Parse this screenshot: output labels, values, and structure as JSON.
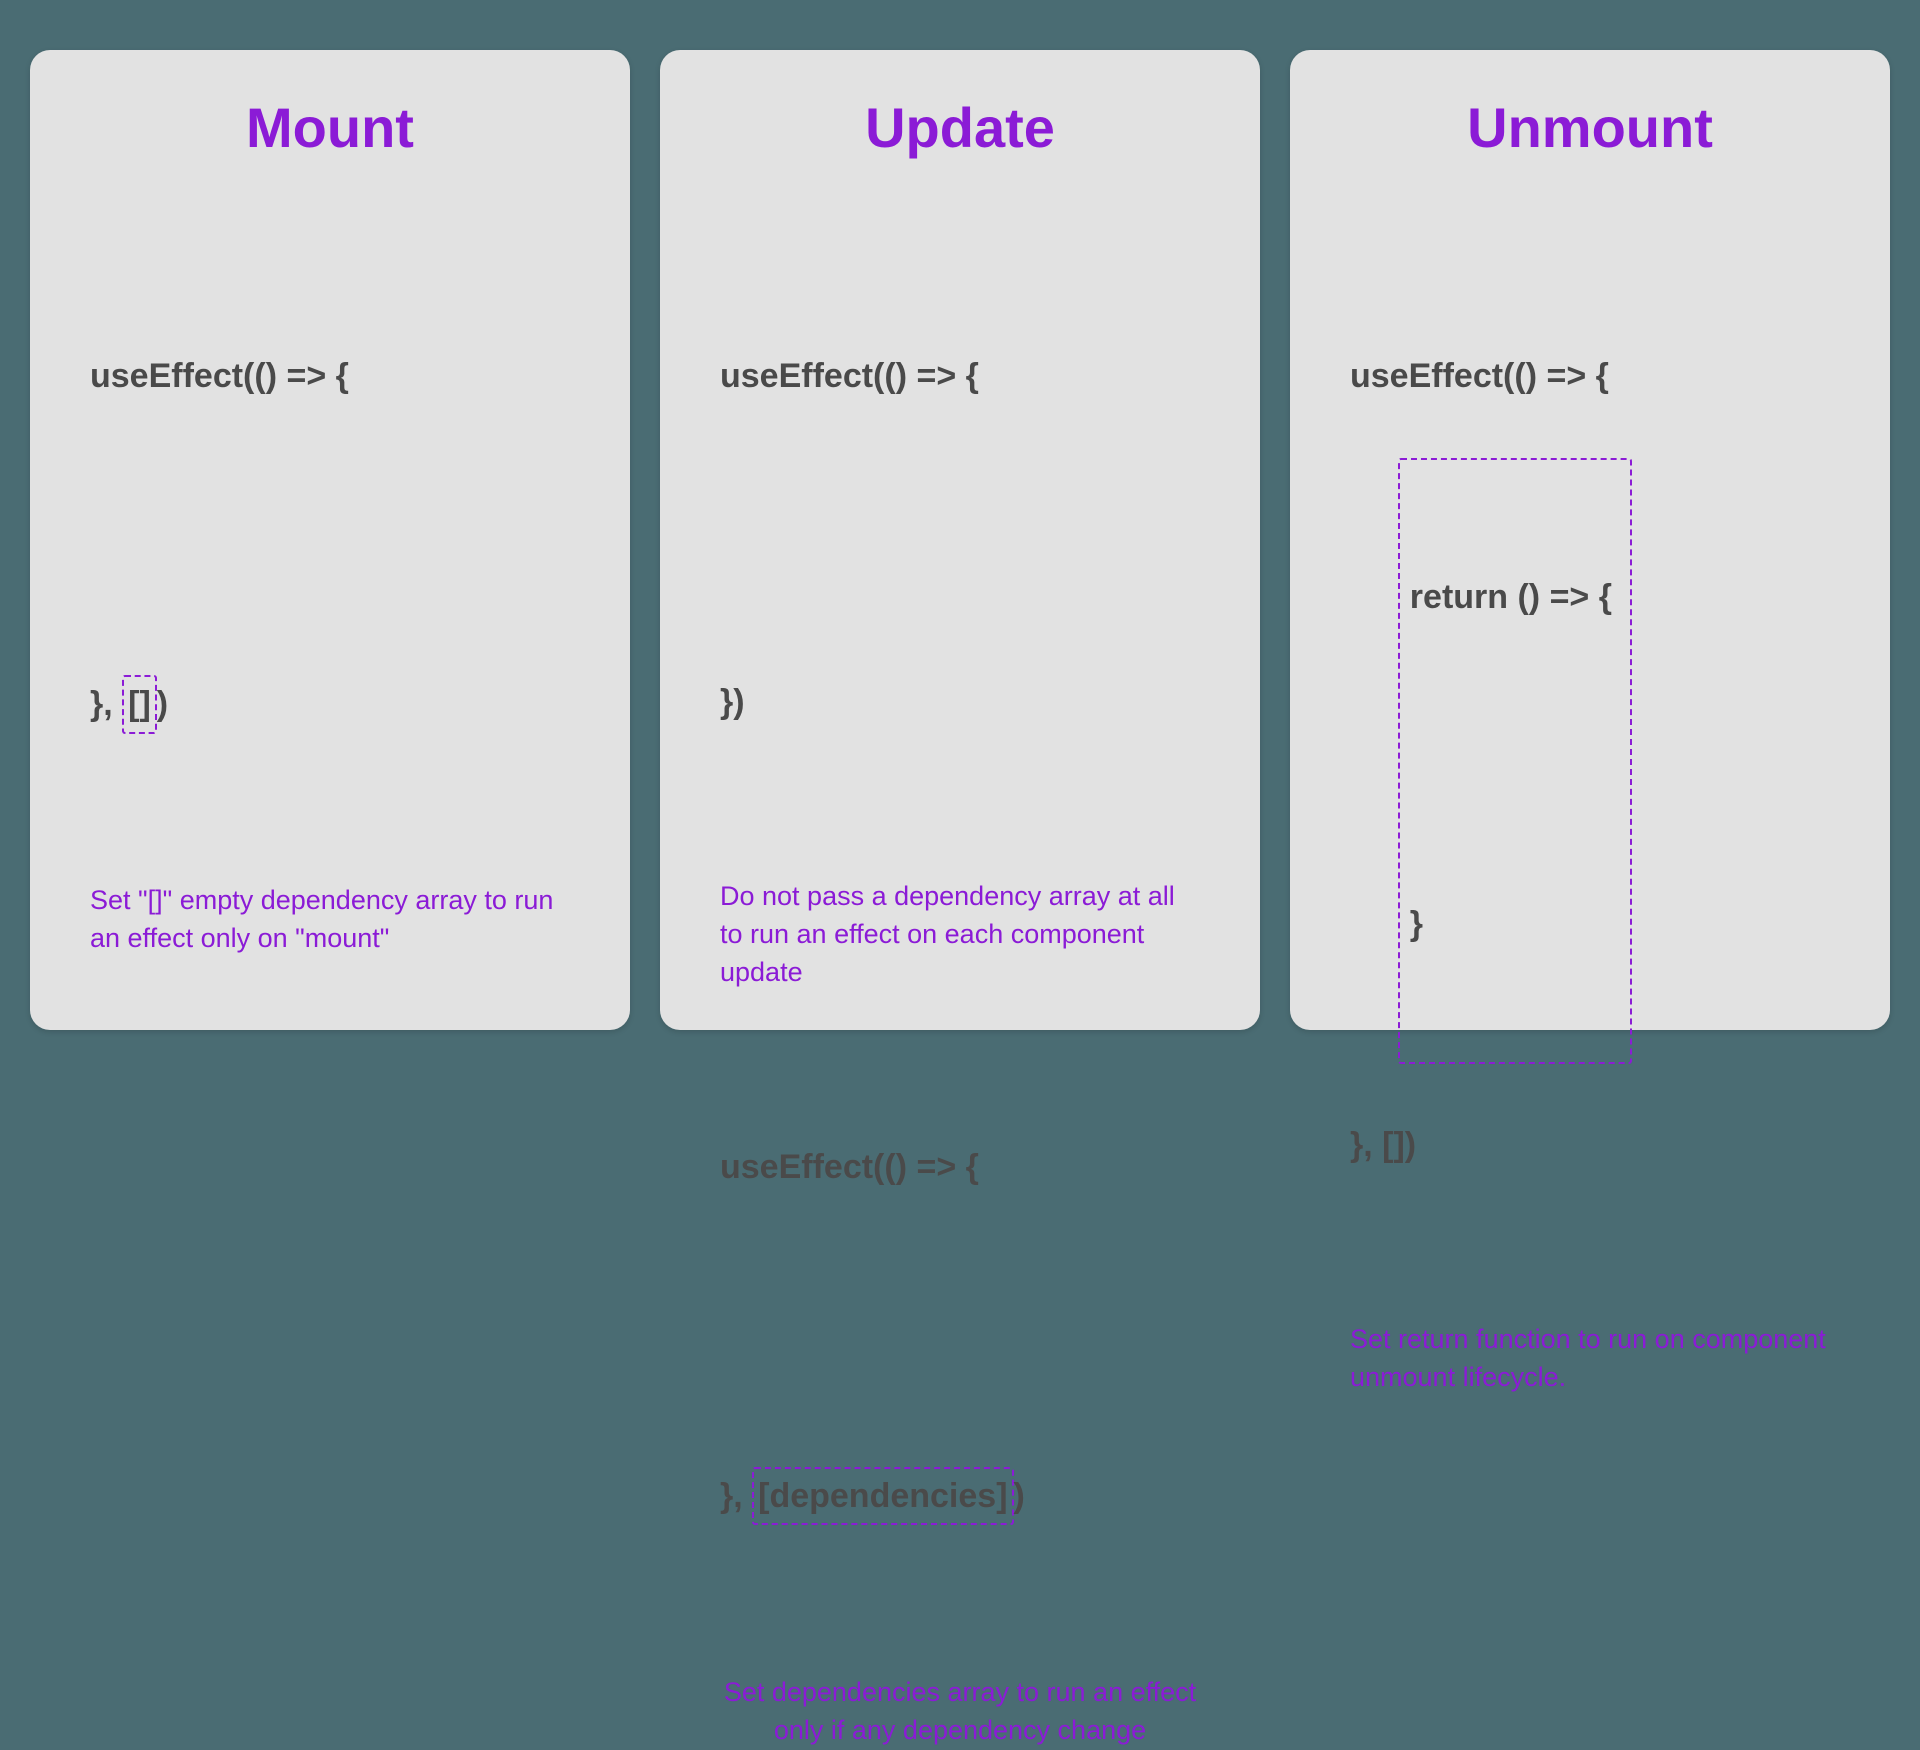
{
  "cards": [
    {
      "title": "Mount",
      "code1_line1": "useEffect(() => {",
      "code1_line2_a": "}, ",
      "code1_line2_box": "[]",
      "code1_line2_b": ")",
      "desc1": "Set \"[]\" empty dependency array to run an effect only on \"mount\""
    },
    {
      "title": "Update",
      "code1_line1": "useEffect(() => {",
      "code1_line2": "})",
      "desc1": "Do not pass a dependency array at all to run an effect on each component update",
      "code2_line1": "useEffect(() => {",
      "code2_line2_a": "}, ",
      "code2_line2_box": "[dependencies]",
      "code2_line2_b": ")",
      "desc2": "Set dependencies array to run an effect only if any dependency change"
    },
    {
      "title": "Unmount",
      "code1_line1": "useEffect(() => {",
      "code1_box_line1": "return () => {",
      "code1_box_line2": "",
      "code1_box_line3": "}",
      "code1_line3": "}, [])",
      "desc1": "Set return function to run on component unmount lifecycle."
    }
  ]
}
